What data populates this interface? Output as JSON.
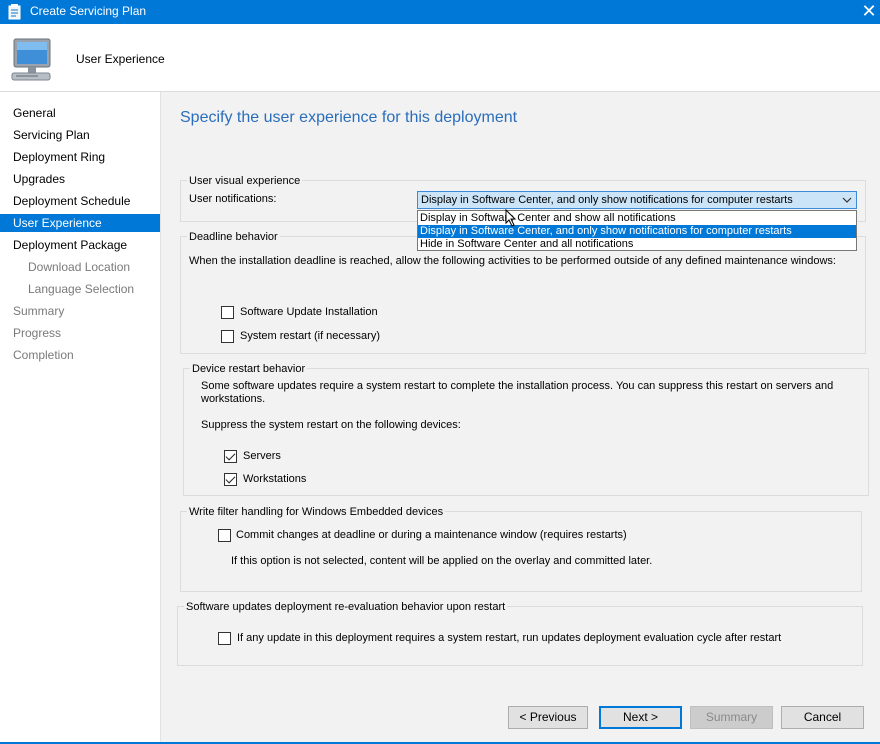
{
  "window": {
    "title": "Create Servicing Plan",
    "close_glyph": "✕"
  },
  "header": {
    "title": "User Experience",
    "icon": "computer-monitor-icon"
  },
  "sidebar": {
    "items": [
      {
        "label": "General",
        "state": "normal"
      },
      {
        "label": "Servicing Plan",
        "state": "normal"
      },
      {
        "label": "Deployment Ring",
        "state": "normal"
      },
      {
        "label": "Upgrades",
        "state": "normal"
      },
      {
        "label": "Deployment Schedule",
        "state": "normal"
      },
      {
        "label": "User Experience",
        "state": "active"
      },
      {
        "label": "Deployment Package",
        "state": "normal"
      },
      {
        "label": "Download Location",
        "state": "sub"
      },
      {
        "label": "Language Selection",
        "state": "sub"
      },
      {
        "label": "Summary",
        "state": "grey"
      },
      {
        "label": "Progress",
        "state": "grey"
      },
      {
        "label": "Completion",
        "state": "grey"
      }
    ]
  },
  "main": {
    "page_title": "Specify the user experience for this deployment",
    "user_visual": {
      "group_label": "User visual experience",
      "notifications_label": "User notifications:",
      "selected": "Display in Software Center, and only show notifications for computer restarts",
      "options": [
        "Display in Software Center and show all notifications",
        "Display in Software Center, and only show notifications for computer restarts",
        "Hide in Software Center and all notifications"
      ],
      "highlighted_index": 1
    },
    "deadline": {
      "group_label": "Deadline behavior",
      "description": "When the installation deadline is reached, allow the following activities to be performed outside of any defined maintenance windows:",
      "software_update_installation": {
        "label": "Software Update Installation",
        "checked": false
      },
      "system_restart": {
        "label": "System restart (if necessary)",
        "checked": false
      }
    },
    "restart": {
      "group_label": "Device restart behavior",
      "description_line1": "Some software updates require a system restart to complete the installation process. You can suppress this restart on servers and",
      "description_line2": "workstations.",
      "suppress_label": "Suppress the system restart on the following devices:",
      "servers": {
        "label": "Servers",
        "checked": true
      },
      "workstations": {
        "label": "Workstations",
        "checked": true
      }
    },
    "write_filter": {
      "group_label": "Write filter handling for Windows Embedded devices",
      "commit": {
        "label": "Commit changes at deadline or during a maintenance window (requires restarts)",
        "checked": false
      },
      "note": "If this option is not selected, content will be applied on the overlay and committed later."
    },
    "reevaluation": {
      "group_label": "Software updates deployment re-evaluation behavior upon restart",
      "option": {
        "label": "If any update in this deployment requires a system restart, run updates deployment evaluation cycle after restart",
        "checked": false
      }
    }
  },
  "footer": {
    "previous": "< Previous",
    "next": "Next >",
    "summary": "Summary",
    "cancel": "Cancel"
  },
  "colors": {
    "accent": "#0078d7",
    "title_text": "#2a6ebb",
    "content_bg": "#f2f2f2"
  }
}
